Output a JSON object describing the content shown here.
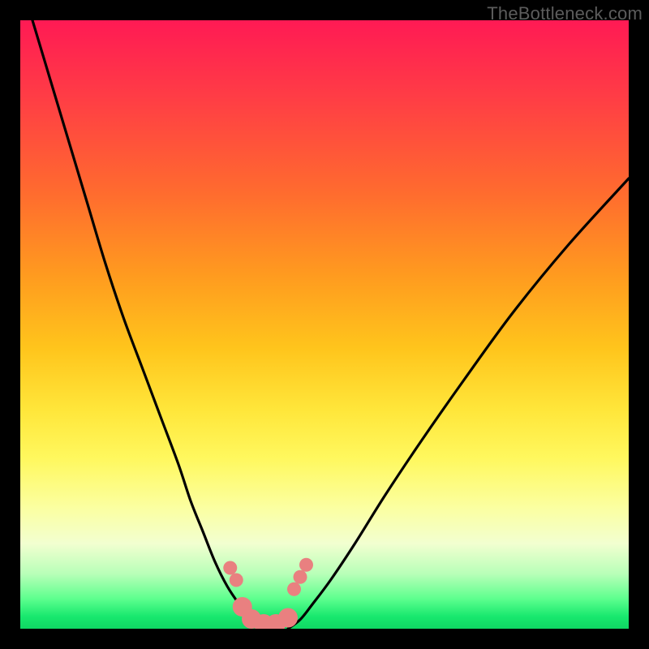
{
  "watermark": "TheBottleneck.com",
  "chart_data": {
    "type": "line",
    "title": "",
    "xlabel": "",
    "ylabel": "",
    "xlim": [
      0,
      100
    ],
    "ylim": [
      0,
      100
    ],
    "series": [
      {
        "name": "left-curve",
        "x": [
          2,
          5,
          8,
          11,
          14,
          17,
          20,
          23,
          26,
          28,
          30,
          32,
          34,
          36,
          38,
          40
        ],
        "values": [
          100,
          90,
          80,
          70,
          60,
          51,
          43,
          35,
          27,
          21,
          16,
          11,
          7,
          4,
          1.5,
          0
        ]
      },
      {
        "name": "right-curve",
        "x": [
          44,
          46,
          48,
          51,
          55,
          60,
          66,
          73,
          81,
          90,
          100
        ],
        "values": [
          0,
          1.5,
          4,
          8,
          14,
          22,
          31,
          41,
          52,
          63,
          74
        ]
      }
    ],
    "markers": {
      "comment": "salmon dotted cluster near the valley",
      "small": [
        {
          "x": 34.5,
          "y": 10.0
        },
        {
          "x": 35.5,
          "y": 8.0
        },
        {
          "x": 45.0,
          "y": 6.5
        },
        {
          "x": 46.0,
          "y": 8.5
        },
        {
          "x": 47.0,
          "y": 10.5
        }
      ],
      "large": [
        {
          "x": 36.5,
          "y": 3.6
        },
        {
          "x": 38.0,
          "y": 1.6
        },
        {
          "x": 40.0,
          "y": 0.8
        },
        {
          "x": 42.0,
          "y": 0.8
        },
        {
          "x": 44.0,
          "y": 1.8
        }
      ]
    },
    "colors": {
      "curve": "#000000",
      "marker": "#e98080",
      "background_top": "#ff1a54",
      "background_bottom": "#0fd763"
    }
  }
}
